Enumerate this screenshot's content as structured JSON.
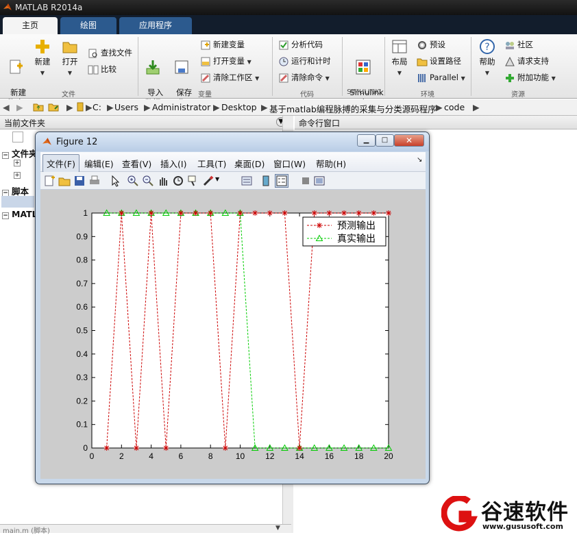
{
  "app": {
    "title": "MATLAB R2014a"
  },
  "tabs": [
    "主页",
    "绘图",
    "应用程序"
  ],
  "ribbon": {
    "file": {
      "new_script": "新建\n脚本",
      "new": "新建",
      "open": "打开",
      "find_files": "查找文件",
      "compare": "比较",
      "section": "文件"
    },
    "variable": {
      "import": "导入\n数据",
      "save_ws": "保存\n工作区",
      "new_var": "新建变量",
      "open_var": "打开变量",
      "clear_ws": "清除工作区",
      "section": "变量"
    },
    "code": {
      "analyze": "分析代码",
      "run_time": "运行和计时",
      "clear_cmd": "清除命令",
      "section": "代码"
    },
    "simulink": {
      "lib": "Simulink\n库",
      "section": "SIMULINK"
    },
    "env": {
      "layout": "布局",
      "prefs": "预设",
      "set_path": "设置路径",
      "parallel": "Parallel",
      "section": "环境"
    },
    "resources": {
      "help": "帮助",
      "community": "社区",
      "support": "请求支持",
      "addons": "附加功能",
      "section": "资源"
    }
  },
  "address": {
    "parts": [
      "C:",
      "Users",
      "Administrator",
      "Desktop",
      "基于matlab编程脉搏的采集与分类源码程序",
      "code"
    ]
  },
  "panels": {
    "current_folder": "当前文件夹",
    "command_window": "命令行窗口",
    "tree": {
      "files": "文件夹",
      "scripts": "脚本",
      "matlab": "MATLAB"
    },
    "bottom": "main.m (脚本)"
  },
  "figure": {
    "title": "Figure 12",
    "menu": [
      "文件(F)",
      "编辑(E)",
      "查看(V)",
      "插入(I)",
      "工具(T)",
      "桌面(D)",
      "窗口(W)",
      "帮助(H)"
    ]
  },
  "watermark": {
    "brand": "谷速软件",
    "url": "www.gususoft.com"
  },
  "colors": {
    "predicted": "#cc0000",
    "actual": "#00cc00",
    "ribbon_tab": "#2c5a8e"
  },
  "chart_data": {
    "type": "line",
    "x": [
      1,
      2,
      3,
      4,
      5,
      6,
      7,
      8,
      9,
      10,
      11,
      12,
      13,
      14,
      15,
      16,
      17,
      18,
      19,
      20
    ],
    "series": [
      {
        "name": "预测输出",
        "marker": "*",
        "line": "dashed",
        "values": [
          0,
          1,
          0,
          1,
          0,
          1,
          1,
          1,
          0,
          1,
          1,
          1,
          1,
          0,
          1,
          1,
          1,
          1,
          1,
          1
        ]
      },
      {
        "name": "真实输出",
        "marker": "triangle",
        "line": "dashed",
        "values": [
          1,
          1,
          1,
          1,
          1,
          1,
          1,
          1,
          1,
          1,
          0,
          0,
          0,
          0,
          0,
          0,
          0,
          0,
          0,
          0
        ]
      }
    ],
    "xticks": [
      "0",
      "2",
      "4",
      "6",
      "8",
      "10",
      "12",
      "14",
      "16",
      "18",
      "20"
    ],
    "yticks": [
      "0",
      "0.1",
      "0.2",
      "0.3",
      "0.4",
      "0.5",
      "0.6",
      "0.7",
      "0.8",
      "0.9",
      "1"
    ],
    "xlim": [
      0,
      20
    ],
    "ylim": [
      0,
      1
    ],
    "legend": "top-right",
    "grid": false
  }
}
